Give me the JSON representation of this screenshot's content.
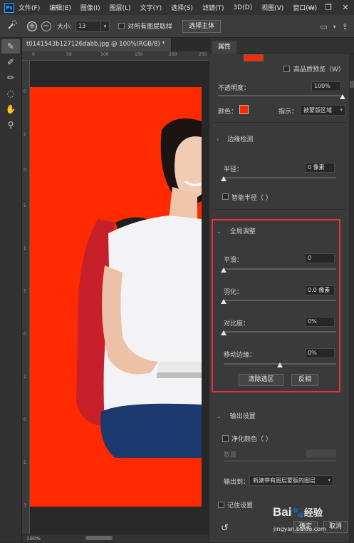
{
  "menubar": {
    "logo": "Ps",
    "items": [
      "文件(F)",
      "编辑(E)",
      "图像(I)",
      "图层(L)",
      "文字(Y)",
      "选择(S)",
      "滤镜(T)",
      "3D(D)",
      "视图(V)",
      "窗口(W)"
    ],
    "controls": [
      "—",
      "❐",
      "✕"
    ]
  },
  "options": {
    "size_label": "大小:",
    "size_value": "13",
    "sample_all_label": "对所有图层取样",
    "select_subject": "选择主体"
  },
  "document": {
    "tab_title": "t0141543b127126dabb.jpg @ 100%(RGB/8) *",
    "close_glyph": "×",
    "zoom": "100%",
    "bg_color": "#ff2a00",
    "ruler_top": [
      "0",
      "50",
      "100",
      "150",
      "200",
      "250"
    ],
    "ruler_left": [
      "0",
      "2",
      "0",
      "5",
      "1",
      "5",
      "0",
      "2",
      "0",
      "5",
      "3"
    ]
  },
  "panel": {
    "tab": "属性",
    "hq_preview": "高品质预览（W）",
    "opacity_label": "不透明度：",
    "opacity_value": "100%",
    "opacity_level": 1.0,
    "color_label": "颜色：",
    "color_value": "#ff2a00",
    "indicate_label": "指示：",
    "indicate_value": "被蒙版区域",
    "edge_detection": {
      "title": "边缘检测",
      "radius_label": "半径：",
      "radius_value": "0 像素",
      "radius_level": 0,
      "smart_radius": "智能半径（ ）"
    },
    "global": {
      "title": "全局调整",
      "smooth_label": "平滑：",
      "smooth_value": "0",
      "smooth_level": 0,
      "feather_label": "羽化：",
      "feather_value": "0.0 像素",
      "feather_level": 0,
      "contrast_label": "对比度：",
      "contrast_value": "0%",
      "contrast_level": 0,
      "shift_label": "移动边缘：",
      "shift_value": "0%",
      "shift_level": 0.5,
      "clear_btn": "清除选区",
      "invert_btn": "反相"
    },
    "output": {
      "title": "输出设置",
      "decontaminate": "净化颜色（ ）",
      "amount_label": "数量",
      "output_to_label": "输出到：",
      "output_to_value": "新建带有图层蒙版的图层",
      "remember": "记住设置"
    },
    "ok": "确定",
    "cancel": "取消"
  },
  "watermark": {
    "brand": "Bai",
    "brand2": "经验",
    "url": "jingyan.baidu.com"
  }
}
